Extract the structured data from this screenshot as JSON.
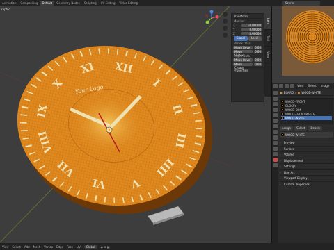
{
  "topbar": {
    "tabs": [
      {
        "label": "Animation",
        "active": false
      },
      {
        "label": "Compositing",
        "active": false
      },
      {
        "label": "Default",
        "active": true
      },
      {
        "label": "Geometry Nodes",
        "active": false
      },
      {
        "label": "Scripting",
        "active": false
      },
      {
        "label": "UV Editing",
        "active": false
      },
      {
        "label": "Video Editing",
        "active": false
      }
    ],
    "scene_label": "Scene"
  },
  "viewport": {
    "label": "raphic",
    "sidebar_tabs": [
      "Item",
      "Tool",
      "View"
    ],
    "transform": {
      "title": "Transform",
      "median_label": "Median:",
      "x_label": "X",
      "x_value": "-0.00000",
      "y_label": "Y",
      "y_value": "0.00000",
      "z_label": "Z",
      "z_value": "0.00000",
      "global_label": "Global",
      "local_label": "Local",
      "vertex_data_label": "Vertex Data:",
      "mean_bevel_weight_label": "Mean Bevel",
      "mean_bevel_weight_value": "0.00",
      "mean_vertex_crease_label": "Mean Vertex",
      "mean_vertex_crease_value": "0.00",
      "edge_data_label": "Edges Data:",
      "edge_bevel_label": "Mean Bevel",
      "edge_bevel_value": "0.00",
      "edge_crease_label": "Mean Crease",
      "edge_crease_value": "0.00",
      "properties_label": "Properties"
    },
    "logo_text": "Your Logo",
    "numerals": [
      "XII",
      "I",
      "II",
      "III",
      "IIII",
      "V",
      "VI",
      "VII",
      "VIII",
      "IX",
      "X",
      "XI"
    ]
  },
  "statusbar": {
    "items": [
      "View",
      "Select",
      "Add",
      "Mesh",
      "Vertex",
      "Edge",
      "Face",
      "UV"
    ],
    "mode": "Global",
    "mode_icons": "◉ ⊞ ▦"
  },
  "image_editor": {
    "menu": [
      "View",
      "Select",
      "Image"
    ]
  },
  "properties": {
    "breadcrumb_object": "BOARD",
    "breadcrumb_material": "WOOD-WHITE",
    "materials": [
      {
        "name": "WOOD-FRONT",
        "selected": false
      },
      {
        "name": "GLOSSY",
        "selected": false
      },
      {
        "name": "WOOD-DIM",
        "selected": false
      },
      {
        "name": "WOOD-FRONT-WHITE",
        "selected": false
      },
      {
        "name": "WOOD-WHITE",
        "selected": true
      }
    ],
    "assign_label": "Assign",
    "select_label": "Select",
    "deselect_label": "Desele",
    "material_field": "WOOD-WHITE",
    "sections": [
      "Preview",
      "Surface",
      "Volume",
      "Displacement",
      "Settings",
      "Line Art",
      "Viewport Display",
      "Custom Properties"
    ]
  },
  "colors": {
    "accent": "#4772b3",
    "clock_face": "#e0891f",
    "numerals": "#e8dcb0",
    "hand_second": "#b51d1d"
  }
}
